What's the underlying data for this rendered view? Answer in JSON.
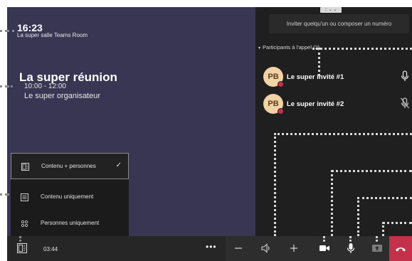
{
  "stage": {
    "clock": "16:23",
    "room_name": "La super salle Teams Room",
    "meeting_title": "La super réunion",
    "meeting_time": "10:00 - 12:00",
    "meeting_organizer": "Le super organisateur",
    "background_color": "#393654"
  },
  "side_panel": {
    "invite_label": "Inviter quelqu'un ou composer un numéro",
    "participants_header": "Participants à l'appel (2)",
    "participants": [
      {
        "initials": "PB",
        "name": "Le super invité #1",
        "mic": "mic-on-icon"
      },
      {
        "initials": "PB",
        "name": "Le super invité #2",
        "mic": "mic-muted-icon"
      }
    ]
  },
  "layout_menu": {
    "items": [
      {
        "label": "Contenu + personnes",
        "icon": "content-people-icon",
        "selected": true
      },
      {
        "label": "Contenu uniquement",
        "icon": "content-only-icon",
        "selected": false
      },
      {
        "label": "Personnes uniquement",
        "icon": "people-only-icon",
        "selected": false
      }
    ]
  },
  "toolbar": {
    "call_duration": "03:44",
    "more_label": "•••",
    "hangup_color": "#c4314b"
  }
}
